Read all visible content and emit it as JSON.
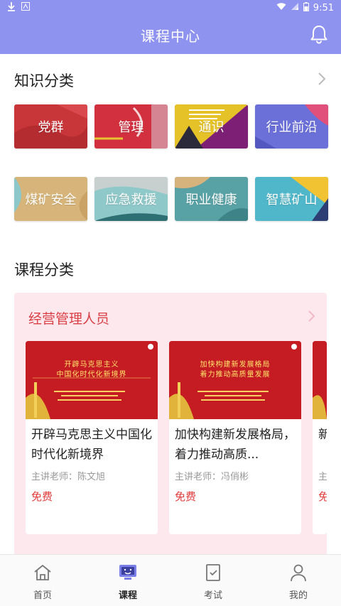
{
  "status_bar": {
    "time": "9:51"
  },
  "header": {
    "title": "课程中心"
  },
  "knowledge": {
    "title": "知识分类",
    "tiles": [
      {
        "label": "党群",
        "color": "#c9363a"
      },
      {
        "label": "管理",
        "color": "#d2303f"
      },
      {
        "label": "通识",
        "color": "#e6c229"
      },
      {
        "label": "行业前沿",
        "color": "#6b70d9"
      },
      {
        "label": "煤矿安全",
        "color": "#d7b57a"
      },
      {
        "label": "应急救援",
        "color": "#8fc8c9"
      },
      {
        "label": "职业健康",
        "color": "#58a2a6"
      },
      {
        "label": "智慧矿山",
        "color": "#4fb7c9"
      }
    ]
  },
  "course_category": {
    "title": "课程分类",
    "block": {
      "title": "经营管理人员",
      "courses": [
        {
          "title": "开辟马克思主义中国化时代化新境界",
          "teacher": "主讲老师：陈文旭",
          "price": "免费",
          "thumb_l1": "开辟马克思主义",
          "thumb_l2": "中国化时代化新境界"
        },
        {
          "title": "加快构建新发展格局，着力推动高质...",
          "teacher": "主讲老师：冯俏彬",
          "price": "免费",
          "thumb_l1": "加快构建新发展格局",
          "thumb_l2": "着力推动高质量发展"
        },
        {
          "title": "新产...",
          "teacher": "主讲",
          "price": "免费",
          "thumb_l1": "",
          "thumb_l2": ""
        }
      ]
    }
  },
  "tabs": [
    {
      "label": "首页",
      "icon": "home-icon"
    },
    {
      "label": "课程",
      "icon": "course-icon",
      "active": true
    },
    {
      "label": "考试",
      "icon": "exam-icon"
    },
    {
      "label": "我的",
      "icon": "profile-icon"
    }
  ]
}
